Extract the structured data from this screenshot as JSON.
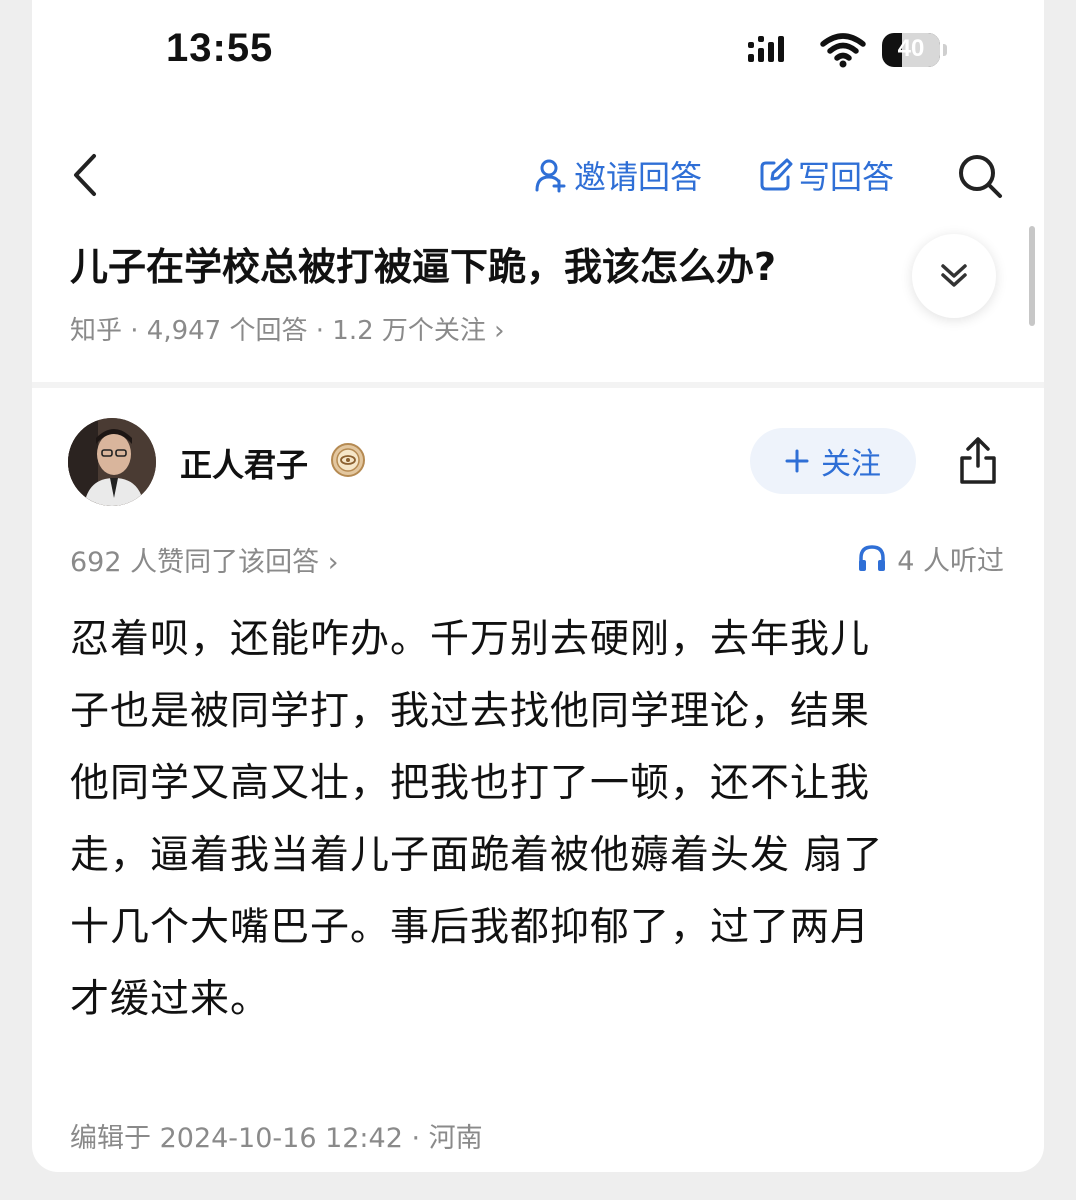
{
  "status_bar": {
    "time": "13:55",
    "battery": "40",
    "icons": [
      "signal-icon",
      "wifi-icon",
      "battery-icon"
    ]
  },
  "nav": {
    "back_icon": "chevron-left-icon",
    "invite_label": "邀请回答",
    "invite_icon": "person-icon",
    "write_label": "写回答",
    "write_icon": "edit-icon",
    "search_icon": "search-icon"
  },
  "question": {
    "title": "儿子在学校总被打被逼下跪，我该怎么办?",
    "meta": "知乎 · 4,947 个回答 · 1.2 万个关注 ›",
    "expand_icon": "double-chevron-down-icon"
  },
  "answer": {
    "author_name": "正人君子",
    "follow_label": "关注",
    "upvote_text": "692 人赞同了该回答 ›",
    "listen_count": "4 人听过",
    "body_lines": [
      "忍着呗，还能咋办。千万别去硬刚，去年我儿",
      "子也是被同学打，我过去找他同学理论，结果",
      "他同学又高又壮，把我也打了一顿，还不让我",
      "走，逼着我当着儿子面跪着被他薅着头发 扇了",
      "十几个大嘴巴子。事后我都抑郁了，过了两月",
      "才缓过来。"
    ],
    "edit_info": "编辑于 2024-10-16 12:42 · 河南"
  },
  "colors": {
    "accent": "#2f6fd6",
    "meta_text": "#8a8a8a",
    "follow_bg": "#eef3fb"
  }
}
